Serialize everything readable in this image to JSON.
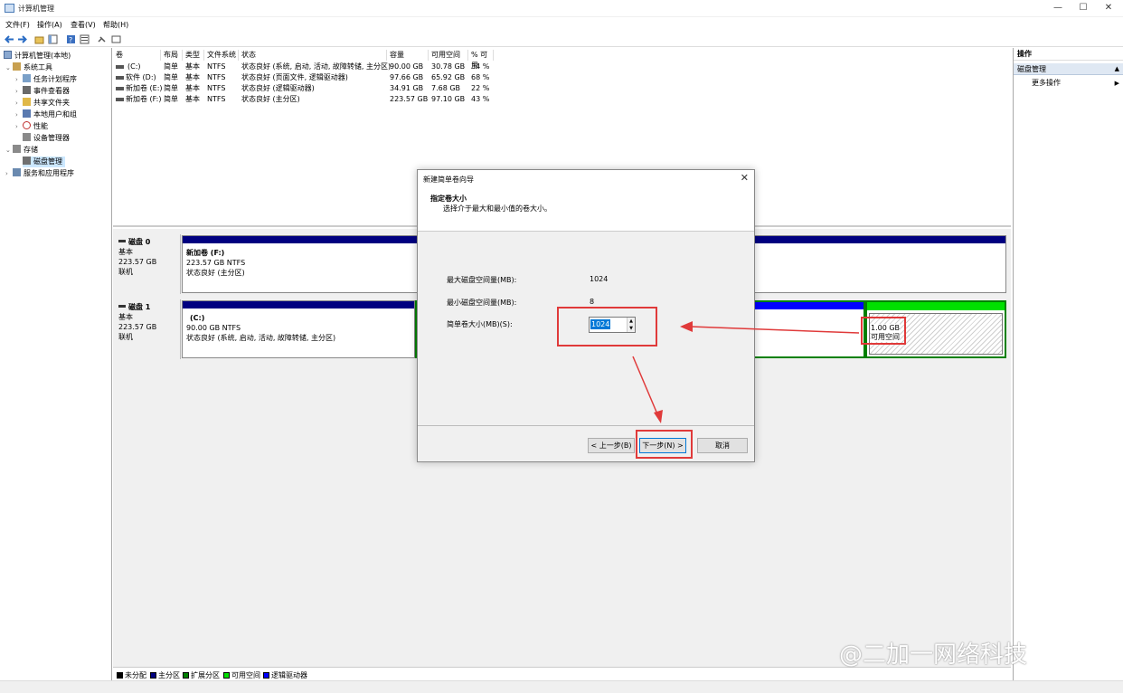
{
  "window": {
    "title": "计算机管理",
    "controls": [
      "—",
      "☐",
      "✕"
    ]
  },
  "menu": [
    "文件(F)",
    "操作(A)",
    "查看(V)",
    "帮助(H)"
  ],
  "tree": {
    "root": "计算机管理(本地)",
    "system_tools": "系统工具",
    "items": [
      "任务计划程序",
      "事件查看器",
      "共享文件夹",
      "本地用户和组",
      "性能",
      "设备管理器"
    ],
    "storage": "存储",
    "disk_management": "磁盘管理",
    "services": "服务和应用程序"
  },
  "volume_table": {
    "headers": [
      "卷",
      "布局",
      "类型",
      "文件系统",
      "状态",
      "容量",
      "可用空间",
      "% 可用"
    ],
    "rows": [
      [
        "(C:)",
        "简单",
        "基本",
        "NTFS",
        "状态良好 (系统, 启动, 活动, 故障转储, 主分区)",
        "90.00 GB",
        "30.78 GB",
        "34 %"
      ],
      [
        "软件 (D:)",
        "简单",
        "基本",
        "NTFS",
        "状态良好 (页面文件, 逻辑驱动器)",
        "97.66 GB",
        "65.92 GB",
        "68 %"
      ],
      [
        "新加卷 (E:)",
        "简单",
        "基本",
        "NTFS",
        "状态良好 (逻辑驱动器)",
        "34.91 GB",
        "7.68 GB",
        "22 %"
      ],
      [
        "新加卷 (F:)",
        "简单",
        "基本",
        "NTFS",
        "状态良好 (主分区)",
        "223.57 GB",
        "97.10 GB",
        "43 %"
      ]
    ]
  },
  "disks": [
    {
      "name": "磁盘 0",
      "type": "基本",
      "size": "223.57 GB",
      "state": "联机",
      "partition": {
        "name": "新加卷  (F:)",
        "size": "223.57 GB NTFS",
        "status": "状态良好 (主分区)"
      }
    },
    {
      "name": "磁盘 1",
      "type": "基本",
      "size": "223.57 GB",
      "state": "联机",
      "partition": {
        "name": "(C:)",
        "size": "90.00 GB NTFS",
        "status": "状态良好 (系统, 启动, 活动, 故障转储, 主分区)"
      },
      "free": {
        "size": "1.00 GB",
        "label": "可用空间"
      }
    }
  ],
  "legend": [
    {
      "label": "未分配",
      "color": "#000000"
    },
    {
      "label": "主分区",
      "color": "#000080"
    },
    {
      "label": "扩展分区",
      "color": "#008000"
    },
    {
      "label": "可用空间",
      "color": "#00e000"
    },
    {
      "label": "逻辑驱动器",
      "color": "#0000ff"
    }
  ],
  "actions": {
    "header": "操作",
    "section": "磁盘管理",
    "more": "更多操作"
  },
  "dialog": {
    "title": "新建简单卷向导",
    "heading": "指定卷大小",
    "subheading": "选择介于最大和最小值的卷大小。",
    "max_label": "最大磁盘空间量(MB):",
    "max_value": "1024",
    "min_label": "最小磁盘空间量(MB):",
    "min_value": "8",
    "size_label": "简单卷大小(MB)(S):",
    "size_value": "1024",
    "back_button": "< 上一步(B)",
    "next_button": "下一步(N) >",
    "cancel_button": "取消"
  },
  "colors": {
    "primary_partition": "#000080",
    "free_space": "#00e000",
    "logical_drive": "#0000ff",
    "highlight_red": "#e03a3a"
  },
  "watermark": "@二加一网络科技"
}
